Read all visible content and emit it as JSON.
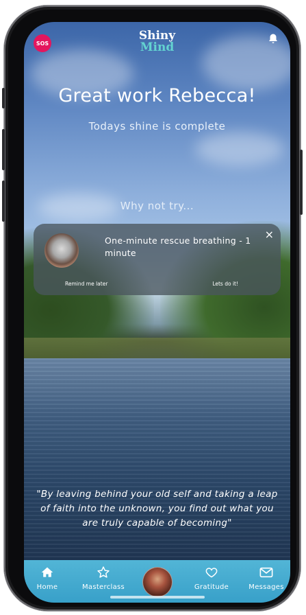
{
  "app": {
    "logo_line1": "Shiny",
    "logo_line2": "Mind",
    "sos_label": "SOS"
  },
  "main": {
    "headline": "Great work Rebecca!",
    "subline": "Todays shine is complete",
    "suggest_label": "Why not try..."
  },
  "suggestion_card": {
    "title": "One-minute rescue breathing - 1 minute",
    "close_label": "×",
    "remind_label": "Remind me later",
    "accept_label": "Lets do it!"
  },
  "quote": {
    "text": "\"By leaving behind your old self and taking a leap of faith into the unknown, you find out what you are truly capable of becoming\""
  },
  "tabs": [
    {
      "label": "Home",
      "icon": "home-icon"
    },
    {
      "label": "Masterclass",
      "icon": "star-icon"
    },
    {
      "label": "Gratitude",
      "icon": "heart-icon"
    },
    {
      "label": "Messages",
      "icon": "mail-icon"
    }
  ],
  "colors": {
    "sos": "#e4165e",
    "brand_teal": "#63d3d0",
    "tabbar": "#3aa2cb"
  }
}
